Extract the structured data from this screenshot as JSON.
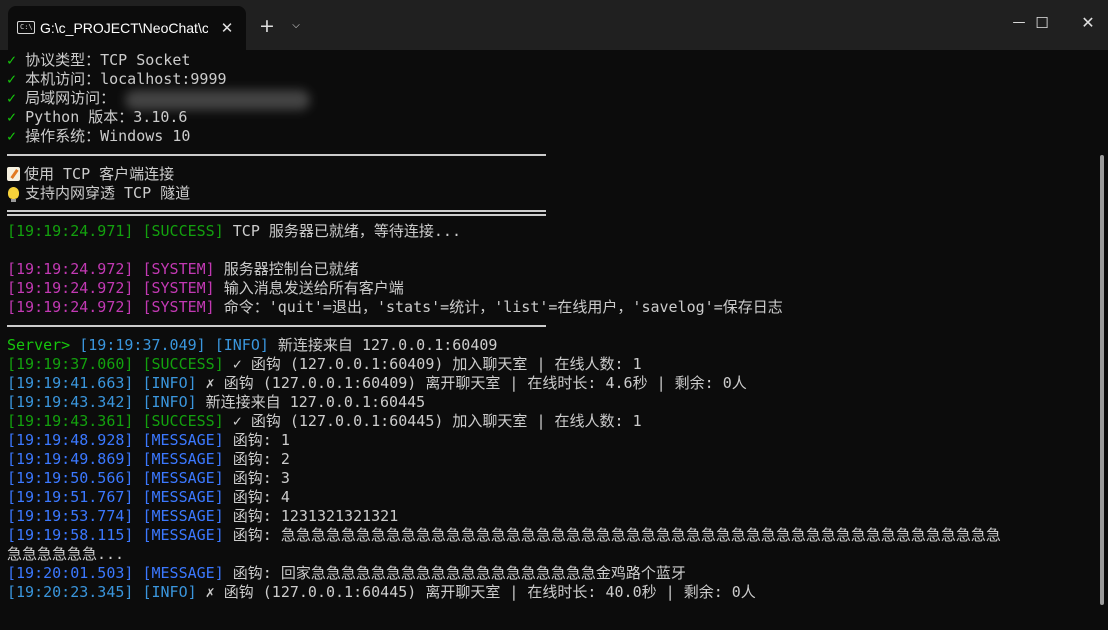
{
  "window": {
    "tab_title": "G:\\c_PROJECT\\NeoChat\\c",
    "tab_icon": "terminal-icon",
    "close_tab_glyph": "✕",
    "new_tab_glyph": "+",
    "dropdown_glyph": "⌄",
    "minimize_glyph": "—",
    "maximize_glyph": "☐",
    "close_glyph": "✕"
  },
  "colors": {
    "background": "#0c0c0c",
    "titlebar": "#202020",
    "bright_green": "#16c60c",
    "green": "#13a10e",
    "magenta": "#c239b3",
    "cyan": "#3a96dd",
    "blue": "#3b78ff",
    "text": "#cccccc"
  },
  "info": [
    {
      "mark": "✓",
      "label": "协议类型：",
      "value": "TCP Socket"
    },
    {
      "mark": "✓",
      "label": "本机访问：",
      "value": "localhost:9999"
    },
    {
      "mark": "✓",
      "label": "局域网访问：",
      "value": ""
    },
    {
      "mark": "✓",
      "label": "Python 版本：",
      "value": "3.10.6"
    },
    {
      "mark": "✓",
      "label": "操作系统：",
      "value": "Windows 10"
    }
  ],
  "tips": [
    {
      "icon": "memo-icon",
      "text": "使用 TCP 客户端连接"
    },
    {
      "icon": "lightbulb-icon",
      "text": "支持内网穿透 TCP 隧道"
    }
  ],
  "ready": {
    "time": "[19:19:24.971]",
    "tag": "[SUCCESS]",
    "text": " TCP 服务器已就绪，等待连接..."
  },
  "system": [
    {
      "time": "[19:19:24.972]",
      "tag": "[SYSTEM]",
      "text": " 服务器控制台已就绪"
    },
    {
      "time": "[19:19:24.972]",
      "tag": "[SYSTEM]",
      "text": " 输入消息发送给所有客户端"
    },
    {
      "time": "[19:19:24.972]",
      "tag": "[SYSTEM]",
      "text": " 命令：'quit'=退出，'stats'=统计，'list'=在线用户，'savelog'=保存日志"
    }
  ],
  "prompt": "Server> ",
  "log": [
    {
      "time": "[19:19:37.049]",
      "tag": "[INFO]",
      "text": " 新连接来自 127.0.0.1:60409",
      "kind": "info"
    },
    {
      "time": "[19:19:37.060]",
      "tag": "[SUCCESS]",
      "text": " ✓ 函钩 (127.0.0.1:60409) 加入聊天室 | 在线人数: 1",
      "kind": "success"
    },
    {
      "time": "[19:19:41.663]",
      "tag": "[INFO]",
      "text": " ✗ 函钩 (127.0.0.1:60409) 离开聊天室 | 在线时长: 4.6秒 | 剩余: 0人",
      "kind": "info"
    },
    {
      "time": "[19:19:43.342]",
      "tag": "[INFO]",
      "text": " 新连接来自 127.0.0.1:60445",
      "kind": "info"
    },
    {
      "time": "[19:19:43.361]",
      "tag": "[SUCCESS]",
      "text": " ✓ 函钩 (127.0.0.1:60445) 加入聊天室 | 在线人数: 1",
      "kind": "success"
    },
    {
      "time": "[19:19:48.928]",
      "tag": "[MESSAGE]",
      "text": " 函钩: 1",
      "kind": "message"
    },
    {
      "time": "[19:19:49.869]",
      "tag": "[MESSAGE]",
      "text": " 函钩: 2",
      "kind": "message"
    },
    {
      "time": "[19:19:50.566]",
      "tag": "[MESSAGE]",
      "text": " 函钩: 3",
      "kind": "message"
    },
    {
      "time": "[19:19:51.767]",
      "tag": "[MESSAGE]",
      "text": " 函钩: 4",
      "kind": "message"
    },
    {
      "time": "[19:19:53.774]",
      "tag": "[MESSAGE]",
      "text": " 函钩: 1231321321321",
      "kind": "message"
    },
    {
      "time": "[19:19:58.115]",
      "tag": "[MESSAGE]",
      "text": " 函钩: 急急急急急急急急急急急急急急急急急急急急急急急急急急急急急急急急急急急急急急急急急急急急急急急急",
      "kind": "message"
    },
    {
      "time": "",
      "tag": "",
      "text": "急急急急急急...",
      "kind": "wrap"
    },
    {
      "time": "[19:20:01.503]",
      "tag": "[MESSAGE]",
      "text": " 函钩: 回家急急急急急急急急急急急急急急急急急急急金鸡路个蓝牙",
      "kind": "message"
    },
    {
      "time": "[19:20:23.345]",
      "tag": "[INFO]",
      "text": " ✗ 函钩 (127.0.0.1:60445) 离开聊天室 | 在线时长: 40.0秒 | 剩余: 0人",
      "kind": "info"
    }
  ]
}
